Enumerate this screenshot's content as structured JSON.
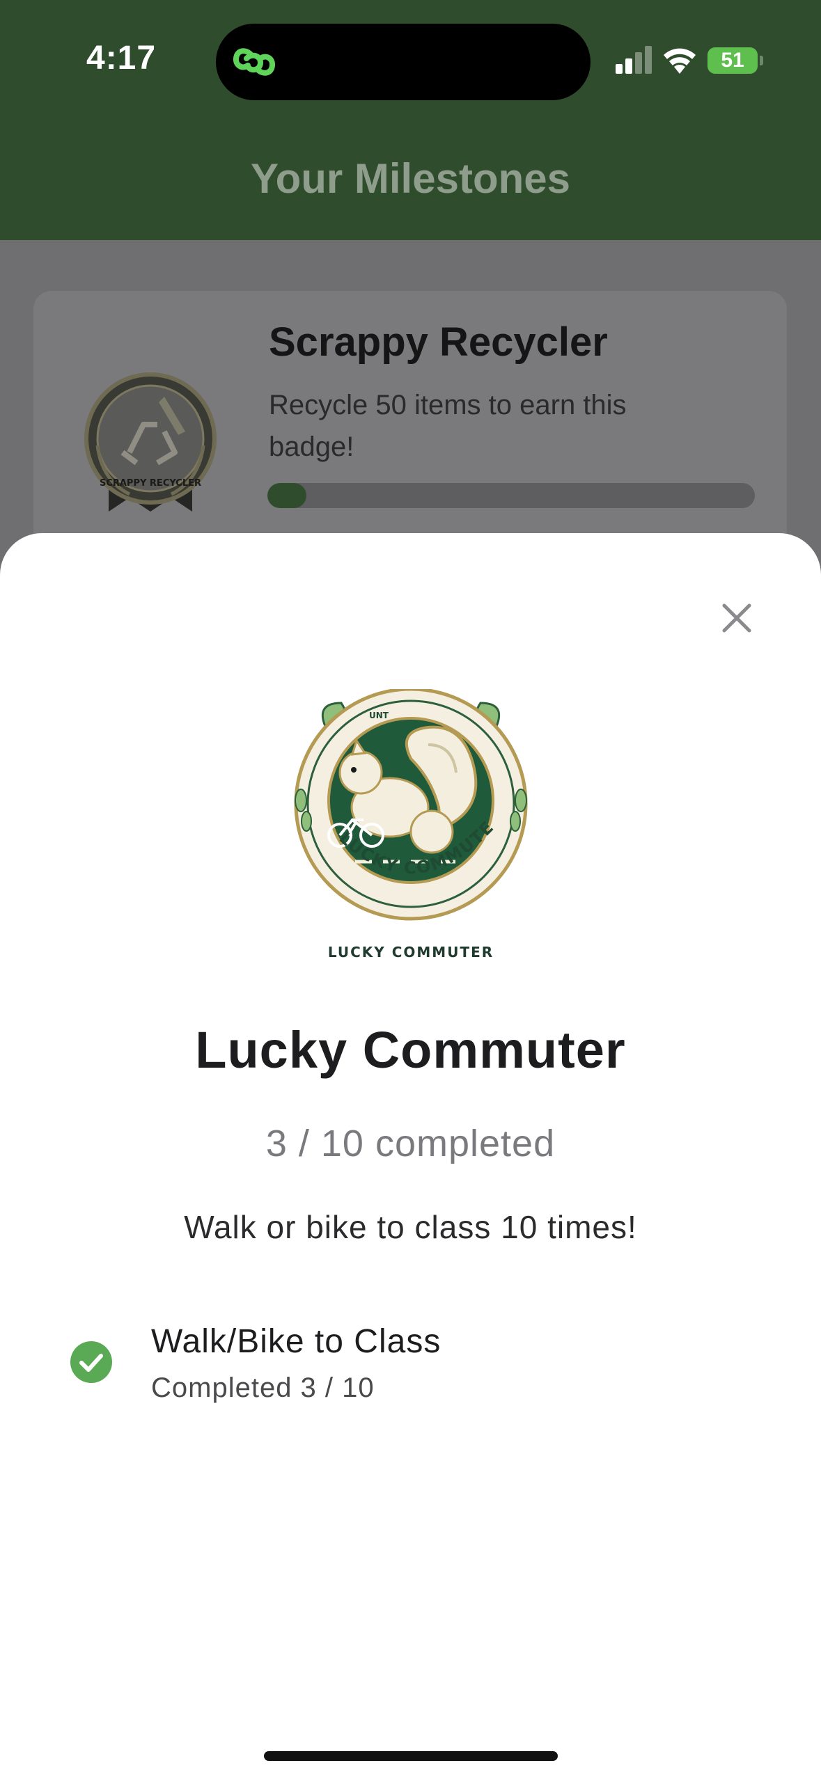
{
  "status_bar": {
    "time": "4:17",
    "battery": "51",
    "icons": [
      "app-link-icon",
      "cellular-signal-icon",
      "wifi-icon",
      "battery-charging-icon"
    ]
  },
  "header": {
    "title": "Your Milestones",
    "color": "#2f4d2d"
  },
  "milestone_card": {
    "title": "Scrappy Recycler",
    "description": "Recycle 50 items to earn this badge!",
    "badge_text": "SCRAPPY RECYCLER",
    "progress_fraction": 0.08
  },
  "modal": {
    "badge_text": "LUCKY COMMUTER",
    "badge_top_text": "UNT",
    "title": "Lucky Commuter",
    "progress_text": "3 / 10 completed",
    "description": "Walk or bike to class 10 times!",
    "task": {
      "title": "Walk/Bike to Class",
      "subtitle": "Completed 3 / 10",
      "status_icon": "check-circle-icon",
      "status_color": "#5aa954"
    },
    "close_icon": "close-icon"
  }
}
